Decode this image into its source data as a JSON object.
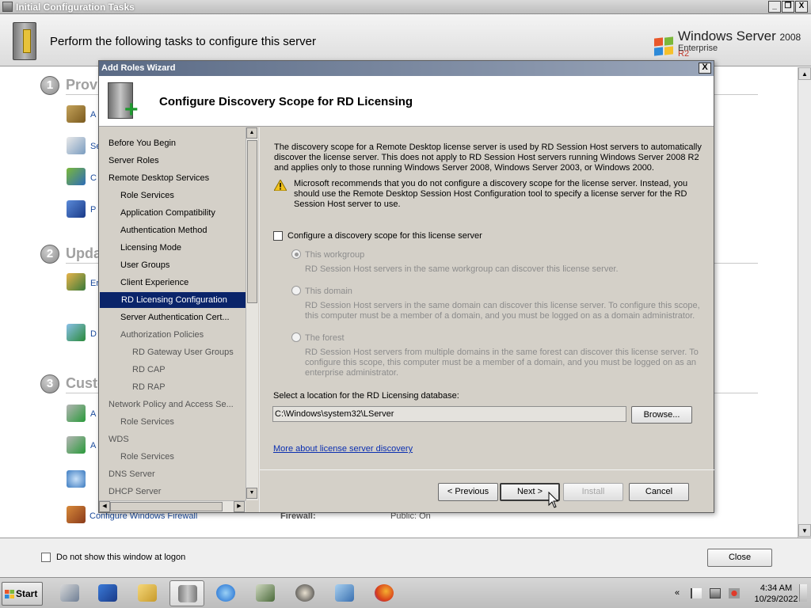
{
  "bg_window": {
    "title": "Initial Configuration Tasks",
    "header": "Perform the following tasks to configure this server",
    "brand_name": "Windows Server",
    "brand_version": "2008",
    "brand_release": "R2",
    "brand_edition": "Enterprise",
    "sections": [
      {
        "num": "1",
        "title": "Provi"
      },
      {
        "num": "2",
        "title": "Upda"
      },
      {
        "num": "3",
        "title": "Custo"
      }
    ],
    "frags": [
      "A",
      "Se",
      "C",
      "P",
      "Er",
      "D",
      "A",
      "A"
    ],
    "firewall_link": "Configure Windows Firewall",
    "firewall_label": "Firewall:",
    "firewall_value": "Public: On",
    "dont_show": "Do not show this window at logon",
    "close": "Close",
    "min": "_",
    "max": "❐",
    "x": "X"
  },
  "dialog": {
    "title": "Add Roles Wizard",
    "close": "X",
    "heading": "Configure Discovery Scope for RD Licensing",
    "nav": [
      {
        "label": "Before You Begin",
        "indent": 0,
        "state": "normal"
      },
      {
        "label": "Server Roles",
        "indent": 0,
        "state": "normal"
      },
      {
        "label": "Remote Desktop Services",
        "indent": 0,
        "state": "normal"
      },
      {
        "label": "Role Services",
        "indent": 1,
        "state": "normal"
      },
      {
        "label": "Application Compatibility",
        "indent": 1,
        "state": "normal"
      },
      {
        "label": "Authentication Method",
        "indent": 1,
        "state": "normal"
      },
      {
        "label": "Licensing Mode",
        "indent": 1,
        "state": "normal"
      },
      {
        "label": "User Groups",
        "indent": 1,
        "state": "normal"
      },
      {
        "label": "Client Experience",
        "indent": 1,
        "state": "normal"
      },
      {
        "label": "RD Licensing Configuration",
        "indent": 1,
        "state": "selected"
      },
      {
        "label": "Server Authentication Cert...",
        "indent": 1,
        "state": "normal"
      },
      {
        "label": "Authorization Policies",
        "indent": 1,
        "state": "dim"
      },
      {
        "label": "RD Gateway User Groups",
        "indent": 2,
        "state": "dim"
      },
      {
        "label": "RD CAP",
        "indent": 2,
        "state": "dim"
      },
      {
        "label": "RD RAP",
        "indent": 2,
        "state": "dim"
      },
      {
        "label": "Network Policy and Access Se...",
        "indent": 0,
        "state": "dim"
      },
      {
        "label": "Role Services",
        "indent": 1,
        "state": "dim"
      },
      {
        "label": "WDS",
        "indent": 0,
        "state": "dim"
      },
      {
        "label": "Role Services",
        "indent": 1,
        "state": "dim"
      },
      {
        "label": "DNS Server",
        "indent": 0,
        "state": "dim"
      },
      {
        "label": "DHCP Server",
        "indent": 0,
        "state": "dim"
      }
    ],
    "description": "The discovery scope for a Remote Desktop license server is used by RD Session Host servers to automatically discover the license server. This does not apply to RD Session Host servers running Windows Server 2008 R2 and applies only to those running Windows Server 2008, Windows Server 2003, or Windows 2000.",
    "warning": "Microsoft recommends that you do not configure a discovery scope for the license server. Instead, you should use the Remote Desktop Session Host Configuration tool to specify a license server for the RD Session Host server to use.",
    "scope_checkbox": "Configure a discovery scope for this license server",
    "scope_checked": false,
    "options": [
      {
        "label": "This workgroup",
        "selected": true,
        "desc": "RD Session Host servers in the same workgroup can discover this license server."
      },
      {
        "label": "This domain",
        "selected": false,
        "desc": "RD Session Host servers in the same domain can discover this license server. To configure this scope, this computer must be a member of a domain, and you must be logged on as a domain administrator."
      },
      {
        "label": "The forest",
        "selected": false,
        "desc": "RD Session Host servers from multiple domains in the same forest can discover this license server. To configure this scope, this computer must be a member of a domain, and you must be logged on as an enterprise administrator."
      }
    ],
    "location_label": "Select a location for the RD Licensing database:",
    "location_value": "C:\\Windows\\system32\\LServer",
    "browse": "Browse...",
    "more_link": "More about license server discovery",
    "buttons": {
      "previous": "< Previous",
      "next": "Next >",
      "install": "Install",
      "cancel": "Cancel"
    }
  },
  "taskbar": {
    "start": "Start",
    "apps": [
      "server-manager-icon",
      "powershell-icon",
      "explorer-icon",
      "initial-config-icon",
      "internet-explorer-icon",
      "network-icon",
      "raccoon-icon",
      "control-panel-icon",
      "firefox-icon"
    ],
    "time": "4:34 AM",
    "date": "10/29/2022",
    "tray_chevron": "«"
  }
}
